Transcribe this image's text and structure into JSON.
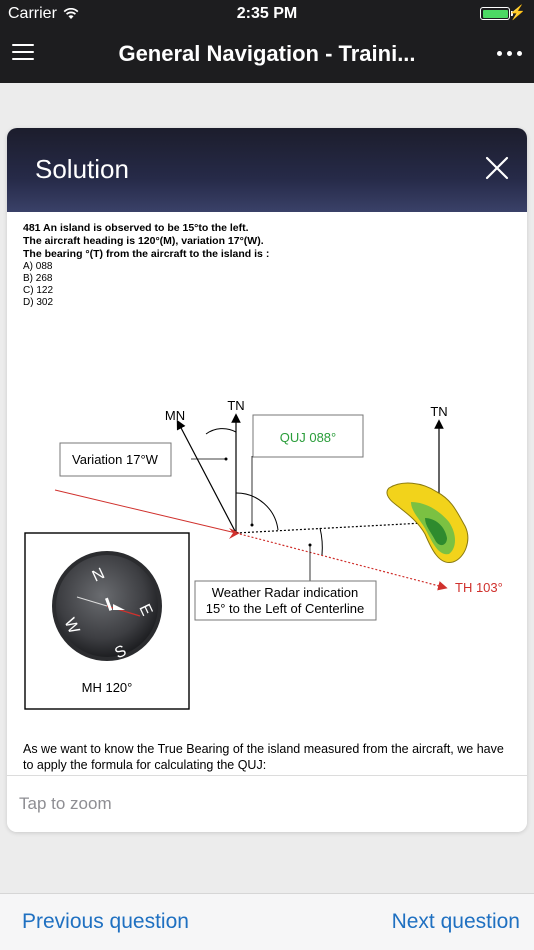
{
  "status_bar": {
    "carrier": "Carrier",
    "time": "2:35 PM"
  },
  "nav": {
    "title": "General Navigation - Traini..."
  },
  "card": {
    "title": "Solution",
    "question": {
      "line1": "481 An island is observed to be 15°to the left.",
      "line2": "The aircraft heading is 120°(M), variation 17°(W).",
      "line3": "The bearing °(T) from the aircraft to the island is :",
      "options": [
        "A) 088",
        "B) 268",
        "C) 122",
        "D) 302"
      ]
    },
    "diagram": {
      "mn_label": "MN",
      "tn_label": "TN",
      "tn_label_right": "TN",
      "quj_label": "QUJ 088°",
      "variation_label": "Variation 17°W",
      "th_label": "TH 103°",
      "radar_line1": "Weather Radar indication",
      "radar_line2": "15° to the Left of Centerline",
      "compass_n": "N",
      "compass_e": "E",
      "compass_s": "S",
      "compass_w": "W",
      "mh_label": "MH 120°"
    },
    "explanation": "As we want to know the True Bearing of the island measured from the aircraft, we have to apply the formula for calculating the QUJ:",
    "zoom_hint": "Tap to zoom"
  },
  "bottom": {
    "previous": "Previous question",
    "next": "Next question"
  },
  "colors": {
    "link": "#1f70c1",
    "quj": "#2a9d3a",
    "th": "#d0312d",
    "island": "#f2d31b"
  }
}
